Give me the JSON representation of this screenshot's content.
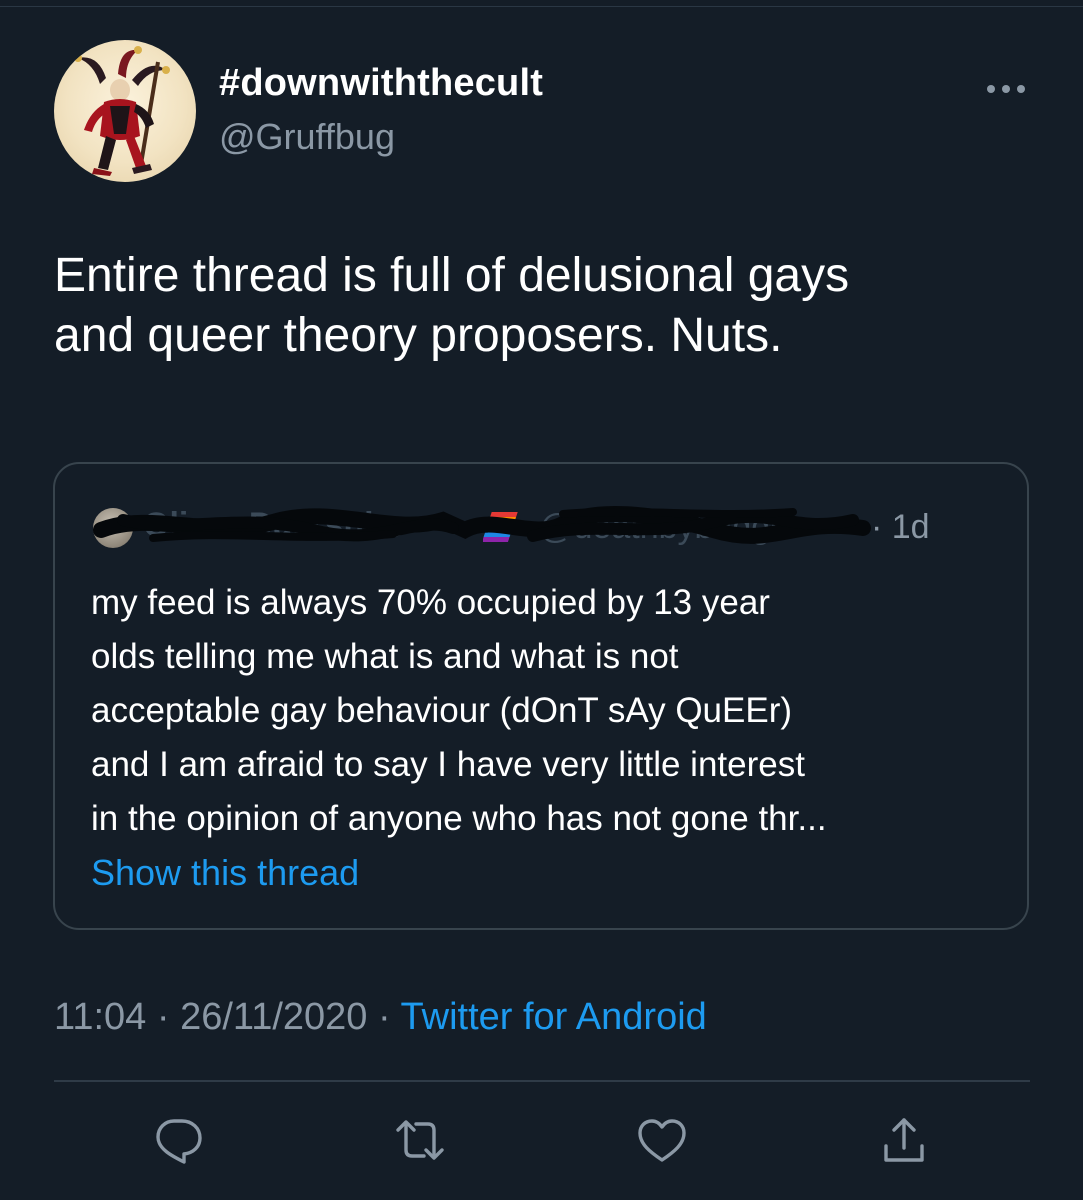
{
  "author": {
    "display_name": "#downwiththecult",
    "handle": "@Gruffbug"
  },
  "tweet": {
    "text_lines": [
      "Entire thread is full of delusional gays",
      "and queer theory proposers. Nuts."
    ]
  },
  "quoted_tweet": {
    "name_visible": "Oliver Darkshire",
    "handle_visible": "@deathbybadger",
    "time": "· 1d",
    "text_lines": [
      "my feed is always 70% occupied by 13 year",
      "olds telling me what is and what is not",
      "acceptable gay behaviour (dOnT sAy QuEEr)",
      "and I am afraid to say I have very little interest",
      "in the opinion of anyone who has not gone thr..."
    ],
    "show_thread_label": "Show this thread"
  },
  "meta": {
    "time": "11:04",
    "separator1": " · ",
    "date": "26/11/2020",
    "separator2": " · ",
    "source": "Twitter for Android"
  },
  "icons": {
    "more": "more-horizontal-icon",
    "reply": "reply-icon",
    "retweet": "retweet-icon",
    "like": "like-icon",
    "share": "share-icon"
  },
  "colors": {
    "background": "#141d27",
    "link": "#1d9bf0",
    "secondary_text": "#8b98a5",
    "border": "#38444d"
  }
}
